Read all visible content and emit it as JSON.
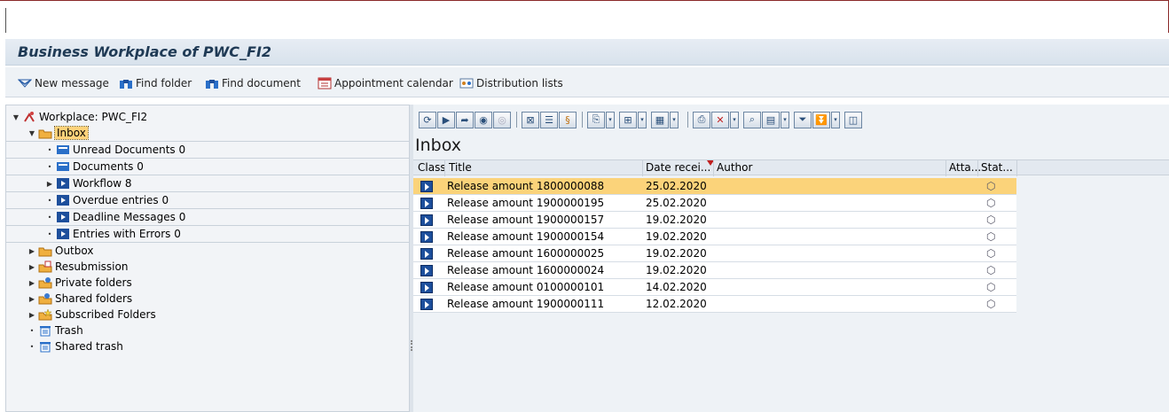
{
  "window": {
    "title": "Business Workplace of PWC_FI2"
  },
  "appbar": {
    "buttons": [
      {
        "label": "New message",
        "icon": "new-message-icon"
      },
      {
        "label": "Find folder",
        "icon": "binoculars-icon"
      },
      {
        "label": "Find document",
        "icon": "binoculars-icon"
      },
      {
        "label": "Appointment calendar",
        "icon": "calendar-icon"
      },
      {
        "label": "Distribution lists",
        "icon": "distribution-list-icon"
      }
    ]
  },
  "tree": {
    "root": "Workplace: PWC_FI2",
    "inbox": "Inbox",
    "inbox_children": [
      "Unread Documents 0",
      "Documents 0",
      "Workflow 8",
      "Overdue entries 0",
      "Deadline Messages 0",
      "Entries with Errors 0"
    ],
    "folders": [
      "Outbox",
      "Resubmission",
      "Private folders",
      "Shared folders",
      "Subscribed Folders",
      "Trash",
      "Shared trash"
    ]
  },
  "content": {
    "heading": "Inbox",
    "columns": {
      "class": "Class",
      "title": "Title",
      "date": "Date recei...",
      "author": "Author",
      "attachment": "Atta...",
      "status": "Stat..."
    },
    "rows": [
      {
        "title": "Release amount 1800000088",
        "date": "25.02.2020",
        "status_icon": "cube-icon",
        "selected": true
      },
      {
        "title": "Release amount 1900000195",
        "date": "25.02.2020",
        "status_icon": "cube-icon"
      },
      {
        "title": "Release amount 1900000157",
        "date": "19.02.2020",
        "status_icon": "cube-icon"
      },
      {
        "title": "Release amount 1900000154",
        "date": "19.02.2020",
        "status_icon": "cube-icon"
      },
      {
        "title": "Release amount 1600000025",
        "date": "19.02.2020",
        "status_icon": "cube-icon"
      },
      {
        "title": "Release amount 1600000024",
        "date": "19.02.2020",
        "status_icon": "cube-icon"
      },
      {
        "title": "Release amount 0100000101",
        "date": "14.02.2020",
        "status_icon": "cube-icon"
      },
      {
        "title": "Release amount 1900000111",
        "date": "12.02.2020",
        "status_icon": "cube-icon"
      }
    ]
  },
  "colors": {
    "selection": "#fbd37a",
    "title_text": "#1f3a55",
    "class_icon": "#1d4f9c"
  }
}
